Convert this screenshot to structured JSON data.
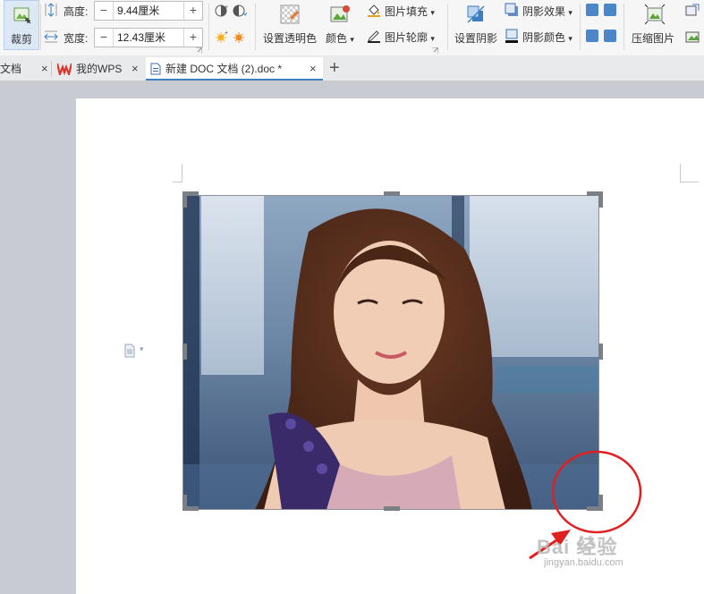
{
  "ribbon": {
    "crop_label": "裁剪",
    "height_label": "高度:",
    "height_value": "9.44厘米",
    "width_label": "宽度:",
    "width_value": "12.43厘米",
    "minus": "−",
    "plus": "+",
    "set_transparent_label": "设置透明色",
    "color_label": "颜色",
    "fill_label": "图片填充",
    "outline_label": "图片轮廓",
    "set_shadow_label": "设置阴影",
    "shadow_effect_label": "阴影效果",
    "shadow_color_label": "阴影颜色",
    "compress_label": "压缩图片",
    "dropdown_arrow": "▾"
  },
  "tabs": [
    {
      "label": "文档",
      "close": "×"
    },
    {
      "label": "我的WPS",
      "close": "×"
    },
    {
      "label": "新建 DOC 文档 (2).doc *",
      "close": "×"
    }
  ],
  "new_tab": "+",
  "watermark": {
    "text": "Bai 经验",
    "url": "jingyan.baidu.com"
  },
  "colors": {
    "accent": "#3c7fc1",
    "annotation": "#e02020",
    "wps_red": "#d9352b"
  }
}
